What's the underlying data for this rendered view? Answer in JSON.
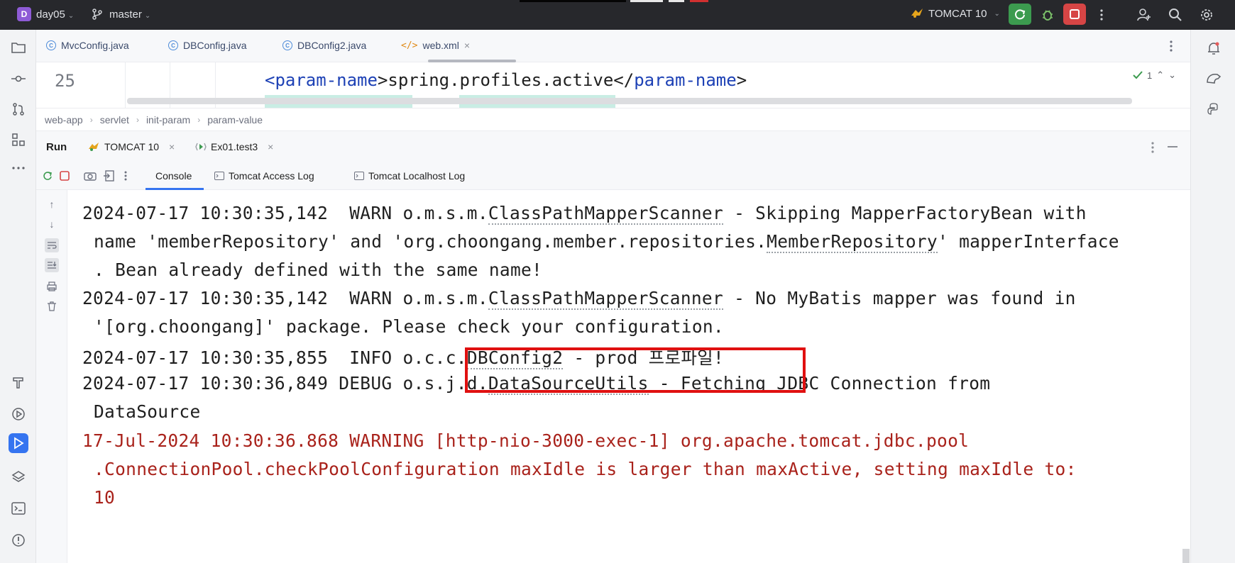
{
  "titlebar": {
    "project_initial": "D",
    "project_name": "day05",
    "branch": "master",
    "run_config": "TOMCAT 10",
    "chevron": "⌄"
  },
  "editor_tabs": [
    {
      "label": "MvcConfig.java",
      "icon": "class-icon"
    },
    {
      "label": "DBConfig.java",
      "icon": "class-icon"
    },
    {
      "label": "DBConfig2.java",
      "icon": "class-icon"
    },
    {
      "label": "web.xml",
      "icon": "xml-icon",
      "active": true,
      "close": "×"
    }
  ],
  "editor": {
    "line_number": "25",
    "open_tag": "<param-name>",
    "tag_name": "param-name",
    "content": "spring.profiles.active",
    "close_tag_name": "param-name",
    "lt": "<",
    "lts": "</",
    "gt": ">",
    "inspection_count": "1"
  },
  "breadcrumb": [
    "web-app",
    "servlet",
    "init-param",
    "param-value"
  ],
  "run_window": {
    "title": "Run",
    "tabs": [
      {
        "label": "TOMCAT 10",
        "close": "×"
      },
      {
        "label": "Ex01.test3",
        "close": "×"
      }
    ]
  },
  "console_tabs": [
    "Console",
    "Tomcat Access Log",
    "Tomcat Localhost Log"
  ],
  "console": {
    "l1_pre": "2024-07-17 10:30:35,142  WARN o.m.s.m.",
    "l1_link": "ClassPathMapperScanner",
    "l1_post": " - Skipping MapperFactoryBean with",
    "l2_pre": "name 'memberRepository' and 'org.choongang.member.repositories.",
    "l2_link": "MemberRepository",
    "l2_post": "' mapperInterface",
    "l3": ". Bean already defined with the same name!",
    "l4_pre": "2024-07-17 10:30:35,142  WARN o.m.s.m.",
    "l4_link": "ClassPathMapperScanner",
    "l4_post": " - No MyBatis mapper was found in",
    "l5": "'[org.choongang]' package. Please check your configuration.",
    "l6_pre": "2024-07-17 10:30:35,855  INFO o.c.c.",
    "l6_link": "DBConfig2",
    "l6_post": " - prod 프로파일!",
    "l7_pre": "2024-07-17 10:30:36,849 DEBUG o.s.j.d.",
    "l7_link": "DataSourceUtils",
    "l7_post": " - Fetching JDBC Connection from",
    "l8": "DataSource",
    "l9": "17-Jul-2024 10:30:36.868 WARNING [http-nio-3000-exec-1] org.apache.tomcat.jdbc.pool",
    "l10": ".ConnectionPool.checkPoolConfiguration maxIdle is larger than maxActive, setting maxIdle to:",
    "l11": "10"
  },
  "colors": {
    "accent": "#3574f0",
    "highlight_box": "#e01010",
    "error_text": "#a9221b",
    "run_green": "#3c9b4f",
    "stop_red": "#d64545"
  }
}
